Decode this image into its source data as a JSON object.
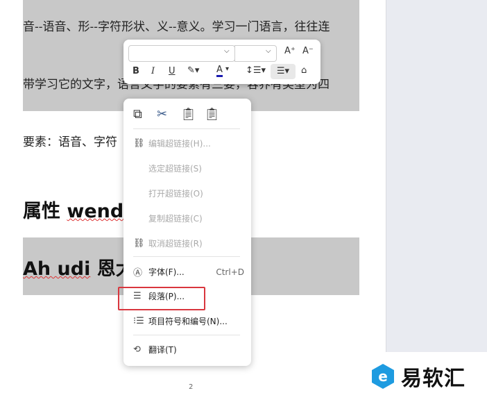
{
  "document": {
    "lines": [
      "音--语音、形--字符形状、义--意义。学习一门语言，往往连",
      "带学习它的文字，语言文字的要素有三要，容养有类型为四",
      "要素：语音、字符"
    ],
    "heading1": {
      "prefix": "属性 ",
      "word": "wend"
    },
    "heading2": {
      "word": "Ah udi",
      "suffix": " 恩大"
    },
    "page_number": "2"
  },
  "toolbar": {
    "font_name": "",
    "font_size": "",
    "grow": "A⁺",
    "shrink": "A⁻",
    "bold": "B",
    "italic": "I",
    "underline": "U",
    "font_color": "A",
    "font_color_hex": "#1a1ab0"
  },
  "menu": {
    "items": [
      {
        "label": "编辑超链接(H)...",
        "disabled": true,
        "icon": "link-icon"
      },
      {
        "label": "选定超链接(S)",
        "disabled": true
      },
      {
        "label": "打开超链接(O)",
        "disabled": true
      },
      {
        "label": "复制超链接(C)",
        "disabled": true
      },
      {
        "label": "取消超链接(R)",
        "disabled": true,
        "icon": "unlink-icon"
      },
      {
        "label": "字体(F)...",
        "shortcut": "Ctrl+D",
        "icon": "font-icon"
      },
      {
        "label": "段落(P)...",
        "icon": "paragraph-icon",
        "highlighted": true
      },
      {
        "label": "项目符号和编号(N)...",
        "icon": "bullet-list-icon"
      },
      {
        "label": "翻译(T)",
        "icon": "translate-icon"
      }
    ]
  },
  "watermark": {
    "text": "易软汇"
  }
}
